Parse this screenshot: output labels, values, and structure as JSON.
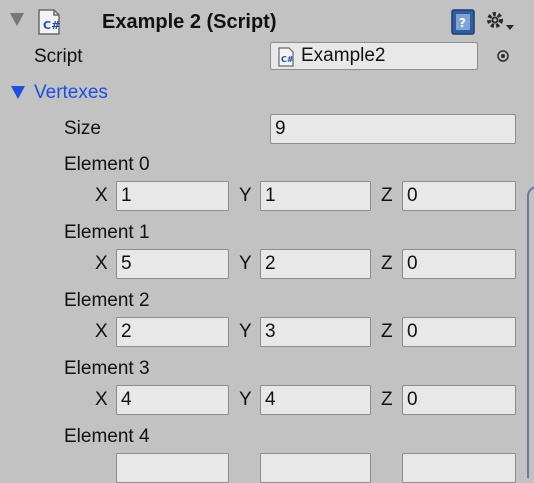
{
  "component": {
    "title": "Example 2 (Script)",
    "script_label": "Script",
    "script_value": "Example2"
  },
  "vertexes": {
    "label": "Vertexes",
    "size_label": "Size",
    "size_value": "9",
    "elements": [
      {
        "label": "Element 0",
        "x": "1",
        "y": "1",
        "z": "0"
      },
      {
        "label": "Element 1",
        "x": "5",
        "y": "2",
        "z": "0"
      },
      {
        "label": "Element 2",
        "x": "2",
        "y": "3",
        "z": "0"
      },
      {
        "label": "Element 3",
        "x": "4",
        "y": "4",
        "z": "0"
      },
      {
        "label": "Element 4",
        "x": "",
        "y": "",
        "z": ""
      }
    ],
    "axis_x": "X",
    "axis_y": "Y",
    "axis_z": "Z"
  },
  "colors": {
    "accent": "#1d4fe0"
  }
}
